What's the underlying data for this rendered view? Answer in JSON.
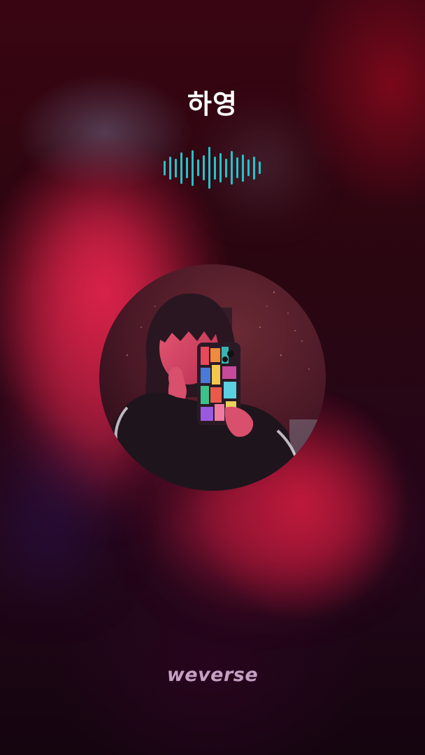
{
  "call": {
    "caller_name": "하영",
    "status_indicator": "audio-waveform-icon",
    "waveform_levels": [
      0.35,
      0.55,
      0.45,
      0.75,
      0.5,
      0.85,
      0.4,
      0.6,
      1.0,
      0.55,
      0.7,
      0.45,
      0.8,
      0.5,
      0.65,
      0.4,
      0.55,
      0.3
    ],
    "waveform_color": "#23c3c9"
  },
  "branding": {
    "logo_text": "weverse",
    "logo_color": "#c69fc4"
  },
  "colors": {
    "background_accent": "#d81e4c",
    "background_dark": "#1a0610"
  }
}
